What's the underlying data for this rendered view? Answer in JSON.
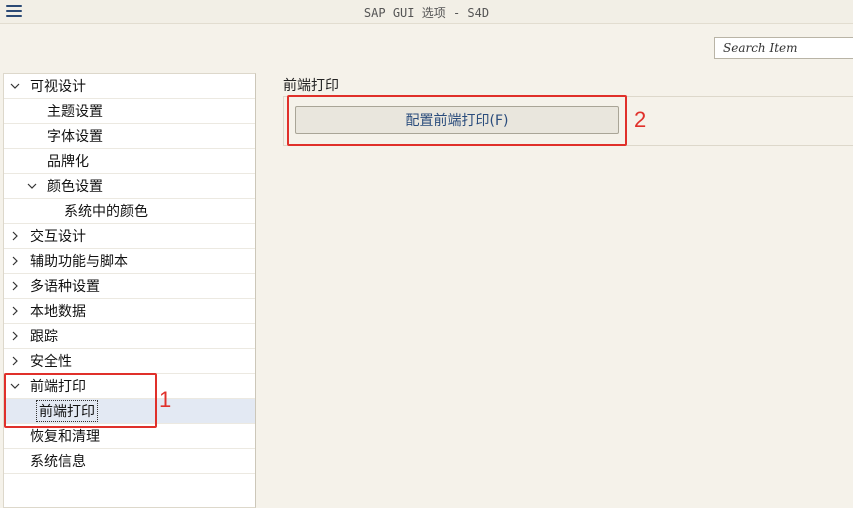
{
  "window": {
    "title": "SAP GUI 选项 - S4D"
  },
  "search": {
    "placeholder": "Search Item"
  },
  "tree": {
    "items": [
      {
        "label": "可视设计",
        "expander": "chevron-down-icon"
      },
      {
        "label": "主题设置"
      },
      {
        "label": "字体设置"
      },
      {
        "label": "品牌化"
      },
      {
        "label": "颜色设置",
        "expander": "chevron-down-icon"
      },
      {
        "label": "系统中的颜色"
      },
      {
        "label": "交互设计",
        "expander": "chevron-right-icon"
      },
      {
        "label": "辅助功能与脚本",
        "expander": "chevron-right-icon"
      },
      {
        "label": "多语种设置",
        "expander": "chevron-right-icon"
      },
      {
        "label": "本地数据",
        "expander": "chevron-right-icon"
      },
      {
        "label": "跟踪",
        "expander": "chevron-right-icon"
      },
      {
        "label": "安全性",
        "expander": "chevron-right-icon"
      },
      {
        "label": "前端打印",
        "expander": "chevron-down-icon"
      },
      {
        "label": "前端打印",
        "selected": true
      },
      {
        "label": "恢复和清理"
      },
      {
        "label": "系统信息"
      }
    ]
  },
  "main": {
    "section_title": "前端打印",
    "config_button_label": "配置前端打印(F)"
  },
  "annotations": [
    {
      "label": "1"
    },
    {
      "label": "2"
    }
  ],
  "colors": {
    "annotation": "#e0302a",
    "button_text": "#2a4c7c",
    "selection": "#e3e9f3"
  }
}
